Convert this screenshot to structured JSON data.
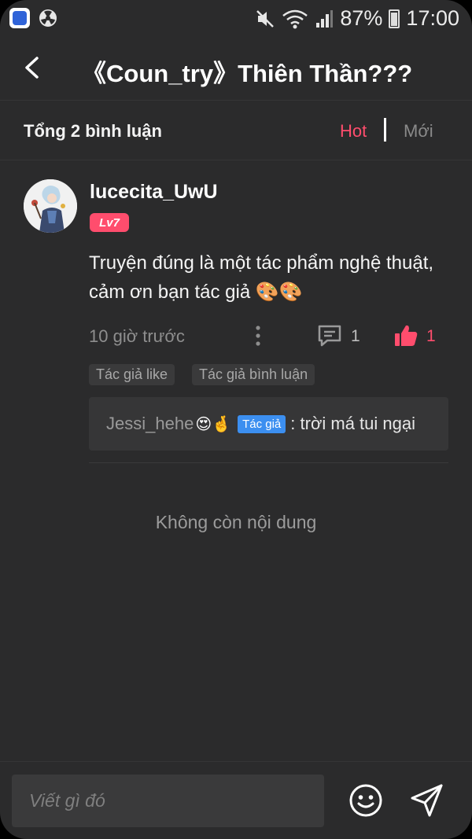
{
  "status_bar": {
    "battery": "87%",
    "time": "17:00"
  },
  "header": {
    "title": "《Coun_try》Thiên Thần???"
  },
  "comments_header": {
    "count_text": "Tổng 2 bình luận",
    "sort_hot": "Hot",
    "sort_separator": "|",
    "sort_new": "Mới"
  },
  "comment": {
    "username": "lucecita_UwU",
    "level": "Lv7",
    "content": "Truyện đúng là một tác phẩm nghệ thuật, cảm ơn bạn tác giả 🎨🎨",
    "timestamp": "10 giờ trước",
    "reply_count": "1",
    "like_count": "1",
    "badges": [
      "Tác giả like",
      "Tác giả bình luận"
    ],
    "reply": {
      "user": "Jessi_hehe",
      "user_emoji": "😍🤞",
      "author_tag": "Tác giả",
      "text": ": trời má tui ngại"
    }
  },
  "no_more_text": "Không còn nội dung",
  "input": {
    "placeholder": "Viết gì đó"
  },
  "colors": {
    "background": "#2b2b2c",
    "accent": "#ff4d6d",
    "author_tag": "#3c8ff0"
  },
  "icons": [
    "back-icon",
    "more-vertical-icon",
    "comment-icon",
    "thumbs-up-icon",
    "smiley-icon",
    "send-icon",
    "mute-icon",
    "wifi-icon",
    "signal-icon",
    "battery-icon"
  ]
}
